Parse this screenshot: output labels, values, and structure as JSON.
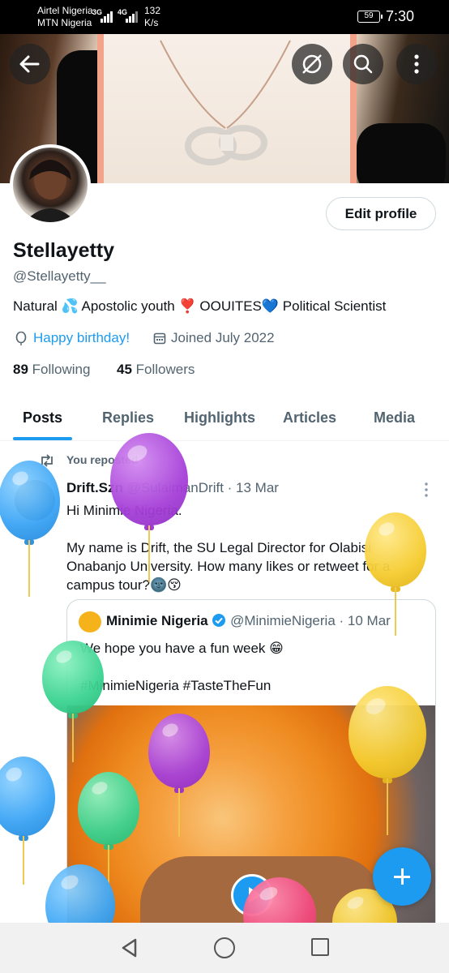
{
  "status_bar": {
    "carrier_1": "Airtel Nigeria",
    "carrier_2": "MTN Nigeria",
    "net_1": "3G",
    "net_2": "4G",
    "speed_value": "132",
    "speed_unit": "K/s",
    "battery": "59",
    "time": "7:30"
  },
  "header": {
    "back_icon": "back-arrow-icon",
    "icons": [
      "no-sync-icon",
      "search-icon",
      "more-vertical-icon"
    ]
  },
  "profile": {
    "edit_button": "Edit profile",
    "display_name": "Stellayetty",
    "handle": "@Stellayetty__",
    "bio": "Natural 💦 Apostolic youth ❣️ OOUITES💙 Political Scientist",
    "birthday_link": "Happy birthday!",
    "joined": "Joined July 2022",
    "following_count": "89",
    "following_label": "Following",
    "followers_count": "45",
    "followers_label": "Followers"
  },
  "tabs": [
    {
      "label": "Posts",
      "active": true
    },
    {
      "label": "Replies",
      "active": false
    },
    {
      "label": "Highlights",
      "active": false
    },
    {
      "label": "Articles",
      "active": false
    },
    {
      "label": "Media",
      "active": false
    }
  ],
  "post": {
    "repost_label": "You reposted",
    "author": "Drift.Szn",
    "handle": "@SulaimanDrift",
    "date": "· 13 Mar",
    "text_1": "Hi Minimie Nigeria.",
    "text_2": "My name is Drift, the SU Legal Director for Olabisi Onabanjo University. How many likes or retweet for a campus tour?🌚😚",
    "quote": {
      "author": "Minimie Nigeria",
      "handle": "@MinimieNigeria",
      "date": "· 10 Mar",
      "logo_text": "Minimie",
      "text_1": "We hope you have a fun week 😁",
      "text_2": "#MinimieNigeria #TasteTheFun"
    }
  },
  "colors": {
    "accent": "#1d9bf0",
    "text_primary": "#0f1419",
    "text_secondary": "#536471",
    "verified": "#1d9bf0"
  },
  "nav": {
    "icons": [
      "nav-back-icon",
      "nav-home-icon",
      "nav-recents-icon"
    ]
  }
}
